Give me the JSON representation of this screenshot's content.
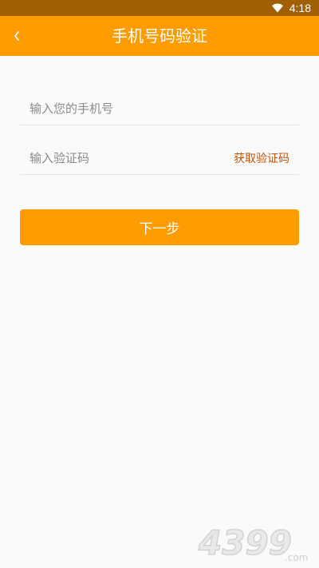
{
  "status_bar": {
    "time": "4:18",
    "wifi_icon": "wifi-icon"
  },
  "app_bar": {
    "title": "手机号码验证",
    "back_icon": "chevron-left-icon",
    "background": "#ff9c00"
  },
  "form": {
    "phone": {
      "placeholder": "输入您的手机号",
      "value": ""
    },
    "code": {
      "placeholder": "输入验证码",
      "value": "",
      "get_code_label": "获取验证码",
      "get_code_color": "#c4520a"
    },
    "next_label": "下一步"
  },
  "watermark": {
    "text": "4399",
    "suffix": ".com"
  }
}
